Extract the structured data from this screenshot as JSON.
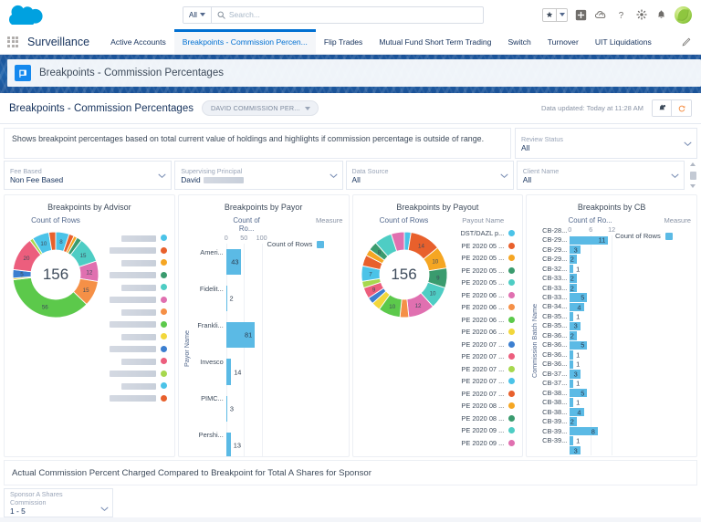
{
  "global_header": {
    "logo": "salesforce-cloud-logo",
    "search": {
      "scope": "All",
      "placeholder": "Search..."
    },
    "icons": [
      "favorites-star-icon",
      "favorites-caret-icon",
      "add-icon",
      "setup-cloud-icon",
      "help-icon",
      "settings-gear-icon",
      "notifications-bell-icon",
      "user-avatar"
    ]
  },
  "app_nav": {
    "app_name": "Surveillance",
    "tabs": [
      {
        "label": "Active Accounts",
        "active": false
      },
      {
        "label": "Breakpoints - Commission Percen...",
        "active": true
      },
      {
        "label": "Flip Trades",
        "active": false
      },
      {
        "label": "Mutual Fund Short Term Trading",
        "active": false
      },
      {
        "label": "Switch",
        "active": false
      },
      {
        "label": "Turnover",
        "active": false
      },
      {
        "label": "UIT Liquidations",
        "active": false
      }
    ],
    "edit_icon": "pencil-icon"
  },
  "banner": {
    "title": "Breakpoints - Commission Percentages",
    "icon": "dashboard-icon"
  },
  "dashboard_header": {
    "title": "Breakpoints - Commission Percentages",
    "badge": "DAVID COMMISSION PER...",
    "updated": "Data updated: Today at 11:28 AM",
    "buttons": [
      "subscribe-bell-icon",
      "refresh-icon"
    ]
  },
  "filters": {
    "description": "Shows breakpoint percentages based on total current value of holdings and highlights if commission percentage is outside of range.",
    "review_status": {
      "label": "Review Status",
      "value": "All"
    },
    "row": [
      {
        "label": "Fee Based",
        "value": "Non Fee Based",
        "redacted": false
      },
      {
        "label": "Supervising Principal",
        "value": "David",
        "redacted": true
      },
      {
        "label": "Data Source",
        "value": "All",
        "redacted": false
      },
      {
        "label": "Client Name",
        "value": "All",
        "redacted": false
      }
    ]
  },
  "chart_data": [
    {
      "type": "pie",
      "title": "Breakpoints by Advisor",
      "metric_label": "Count of Rows",
      "total": "156",
      "legend_title": "",
      "labels": [
        "",
        "",
        "",
        "",
        "",
        "",
        "",
        "",
        "",
        "",
        "",
        "",
        "",
        ""
      ],
      "values": [
        8,
        3,
        2,
        3,
        15,
        12,
        15,
        56,
        1,
        5,
        20,
        2,
        10,
        4
      ],
      "colors": [
        "#4bc3e8",
        "#e8602c",
        "#f5a623",
        "#3a9b6e",
        "#4ecdc4",
        "#e070b0",
        "#f59047",
        "#5cc94b",
        "#f2d73c",
        "#3c7fd0",
        "#ec5e7d",
        "#a7d84e",
        "#4bc3e8",
        "#e8602c"
      ],
      "legend_redacted": true,
      "legend_colors": [
        "#4bc3e8",
        "#e8602c",
        "#f5a623",
        "#3a9b6e",
        "#4ecdc4",
        "#e070b0",
        "#f59047",
        "#5cc94b",
        "#f2d73c",
        "#3c7fd0",
        "#ec5e7d",
        "#a7d84e",
        "#4bc3e8",
        "#e8602c"
      ],
      "slice_labels": [
        "8",
        "",
        "",
        "",
        "15",
        "12",
        "15",
        "56",
        "",
        "5",
        "20",
        "",
        "10",
        ""
      ]
    },
    {
      "type": "bar",
      "title": "Breakpoints by Payor",
      "metric_label": "Count of Ro...",
      "axis_label": "Payor Name",
      "ticks": [
        "0",
        "50",
        "100"
      ],
      "xmax": 115,
      "categories": [
        "Ameri...",
        "Fidelit...",
        "Frankli...",
        "Invesco",
        "PIMC...",
        "Pershi..."
      ],
      "values": [
        43,
        2,
        81,
        14,
        3,
        13
      ],
      "bar_color": "#5bbae5",
      "measure_head": "Measure",
      "measure_name": "Count of Rows"
    },
    {
      "type": "pie",
      "title": "Breakpoints by Payout",
      "metric_label": "Count of Rows",
      "total": "156",
      "legend_title": "Payout Name",
      "labels": [
        "DST/DAZL p...",
        "PE 2020 05 ...",
        "PE 2020 05 ...",
        "PE 2020 05 ...",
        "PE 2020 05 ...",
        "PE 2020 06 ...",
        "PE 2020 06 ...",
        "PE 2020 06 ...",
        "PE 2020 06 ...",
        "PE 2020 07 ...",
        "PE 2020 07 ...",
        "PE 2020 07 ...",
        "PE 2020 07 ...",
        "PE 2020 07 ...",
        "PE 2020 08 ...",
        "PE 2020 08 ...",
        "PE 2020 09 ...",
        "PE 2020 09 ..."
      ],
      "values": [
        3,
        14,
        10,
        9,
        10,
        12,
        4,
        10,
        4,
        3,
        5,
        3,
        7,
        5,
        3,
        4,
        8,
        6
      ],
      "colors": [
        "#4bc3e8",
        "#e8602c",
        "#f5a623",
        "#3a9b6e",
        "#4ecdc4",
        "#e070b0",
        "#f59047",
        "#5cc94b",
        "#f2d73c",
        "#3c7fd0",
        "#ec5e7d",
        "#a7d84e",
        "#4bc3e8",
        "#e8602c",
        "#f5a623",
        "#3a9b6e",
        "#4ecdc4",
        "#e070b0"
      ],
      "slice_labels": [
        "",
        "14",
        "10",
        "9",
        "10",
        "12",
        "",
        "10",
        "",
        "",
        "9",
        "",
        "7",
        "",
        "",
        "8",
        "",
        ""
      ]
    },
    {
      "type": "bar",
      "title": "Breakpoints by CB",
      "metric_label": "Count of Ro...",
      "axis_label": "Commission Batch Name",
      "ticks": [
        "0",
        "6",
        "12"
      ],
      "xmax": 13,
      "categories": [
        "CB-28...",
        "CB-29...",
        "CB-29...",
        "CB-29...",
        "CB-32...",
        "CB-33...",
        "CB-33...",
        "CB-33...",
        "CB-34...",
        "CB-35...",
        "CB-35...",
        "CB-36...",
        "CB-36...",
        "CB-36...",
        "CB-36...",
        "CB-37...",
        "CB-37...",
        "CB-38...",
        "CB-38...",
        "CB-38...",
        "CB-39...",
        "CB-39...",
        "CB-39..."
      ],
      "values": [
        11,
        3,
        2,
        1,
        2,
        2,
        5,
        4,
        1,
        3,
        2,
        5,
        1,
        1,
        3,
        1,
        5,
        1,
        4,
        2,
        8,
        1,
        3
      ],
      "bar_color": "#5bbae5",
      "measure_head": "Measure",
      "measure_name": "Count of Rows"
    }
  ],
  "bottom": {
    "title": "Actual Commission Percent Charged Compared to Breakpoint for Total A Shares for Sponsor",
    "filter": {
      "label": "Sponsor A Shares Commission",
      "value": "1 - 5"
    }
  }
}
